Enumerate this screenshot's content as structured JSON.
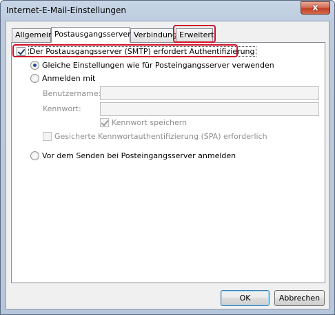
{
  "window": {
    "title": "Internet-E-Mail-Einstellungen",
    "close_glyph": "x"
  },
  "tabs": [
    {
      "label": "Allgemein"
    },
    {
      "label": "Postausgangsserver"
    },
    {
      "label": "Verbindung"
    },
    {
      "label": "Erweitert"
    }
  ],
  "smtp": {
    "auth_required_label": "Der Postausgangsserver (SMTP) erfordert Authentifizierung",
    "auth_required_checked": true,
    "same_settings_label": "Gleiche Einstellungen wie für Posteingangsserver verwenden",
    "logon_with_label": "Anmelden mit",
    "username_label": "Benutzername:",
    "username_value": "",
    "password_label": "Kennwort:",
    "password_value": "",
    "save_password_label": "Kennwort speichern",
    "save_password_checked": true,
    "spa_label": "Gesicherte Kennwortauthentifizierung (SPA) erforderlich",
    "spa_checked": false,
    "logon_before_send_label": "Vor dem Senden bei Posteingangsserver anmelden",
    "selected_option": "same_settings"
  },
  "buttons": {
    "ok": "OK",
    "cancel": "Abbrechen"
  },
  "colors": {
    "highlight": "#d0102a",
    "titlebar": "#bccbde"
  }
}
